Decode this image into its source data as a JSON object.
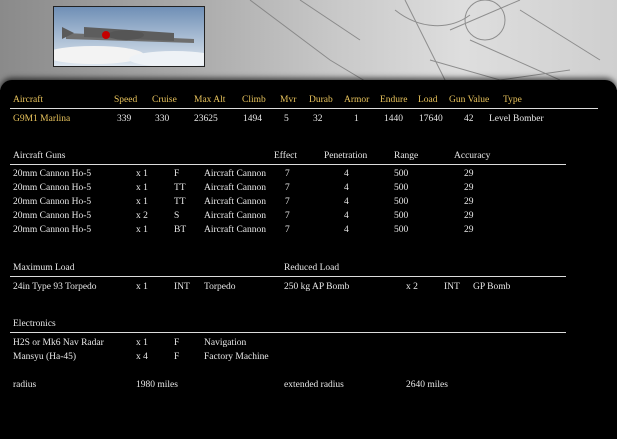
{
  "header": {
    "columns": [
      "Aircraft",
      "Speed",
      "Cruise",
      "Max Alt",
      "Climb",
      "Mvr",
      "Durab",
      "Armor",
      "Endure",
      "Load",
      "Gun Value",
      "Type"
    ],
    "row": [
      "G9M1 Marlina",
      "339",
      "330",
      "23625",
      "1494",
      "5",
      "32",
      "1",
      "1440",
      "17640",
      "42",
      "Level Bomber"
    ]
  },
  "guns": {
    "title": "Aircraft Guns",
    "columns": [
      "Effect",
      "Penetration",
      "Range",
      "Accuracy"
    ],
    "rows": [
      [
        "20mm Cannon Ho-5",
        "x 1",
        "F",
        "Aircraft Cannon",
        "7",
        "4",
        "500",
        "29"
      ],
      [
        "20mm Cannon Ho-5",
        "x 1",
        "TT",
        "Aircraft Cannon",
        "7",
        "4",
        "500",
        "29"
      ],
      [
        "20mm Cannon Ho-5",
        "x 1",
        "TT",
        "Aircraft Cannon",
        "7",
        "4",
        "500",
        "29"
      ],
      [
        "20mm Cannon Ho-5",
        "x 2",
        "S",
        "Aircraft Cannon",
        "7",
        "4",
        "500",
        "29"
      ],
      [
        "20mm Cannon Ho-5",
        "x 1",
        "BT",
        "Aircraft Cannon",
        "7",
        "4",
        "500",
        "29"
      ]
    ]
  },
  "load": {
    "max_title": "Maximum Load",
    "reduced_title": "Reduced Load",
    "max_row": [
      "24in Type 93 Torpedo",
      "x 1",
      "INT",
      "Torpedo"
    ],
    "reduced_row": [
      "250 kg AP Bomb",
      "x 2",
      "INT",
      "GP Bomb"
    ]
  },
  "electronics": {
    "title": "Electronics",
    "rows": [
      [
        "H2S or Mk6 Nav Radar",
        "x 1",
        "F",
        "Navigation"
      ],
      [
        "Mansyu (Ha-45)",
        "x 4",
        "F",
        "Factory Machine"
      ]
    ]
  },
  "radius": {
    "label": "radius",
    "value": "1980 miles",
    "ext_label": "extended radius",
    "ext_value": "2640 miles"
  },
  "colors": {
    "header_text": "#e8c35c",
    "body_text": "#e8e8e8",
    "background": "#000000"
  }
}
